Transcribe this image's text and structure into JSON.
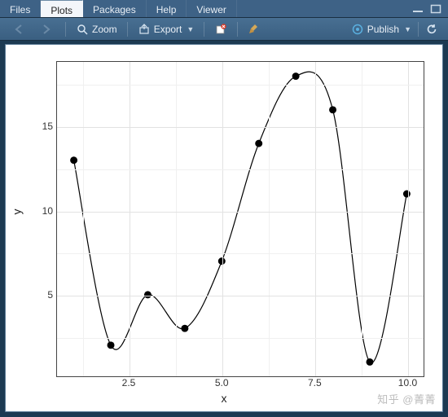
{
  "tabs": {
    "items": [
      "Files",
      "Plots",
      "Packages",
      "Help",
      "Viewer"
    ],
    "active_index": 1
  },
  "toolbar": {
    "back": "Back",
    "forward": "Forward",
    "zoom": "Zoom",
    "export": "Export",
    "remove": "Remove current plot",
    "clear": "Clear all plots",
    "publish": "Publish",
    "refresh": "Refresh"
  },
  "chart_data": {
    "type": "line",
    "x": [
      1,
      2,
      3,
      4,
      5,
      6,
      7,
      8,
      9,
      10
    ],
    "y": [
      13,
      2,
      5,
      3,
      7,
      14,
      18,
      16,
      1,
      11
    ],
    "xlabel": "x",
    "ylabel": "y",
    "xlim": [
      0.55,
      10.45
    ],
    "ylim": [
      0.15,
      18.85
    ],
    "x_ticks": [
      2.5,
      5.0,
      7.5,
      10.0
    ],
    "y_ticks": [
      5,
      10,
      15
    ],
    "grid": true,
    "smooth": true
  },
  "watermark": "知乎 @菁菁"
}
